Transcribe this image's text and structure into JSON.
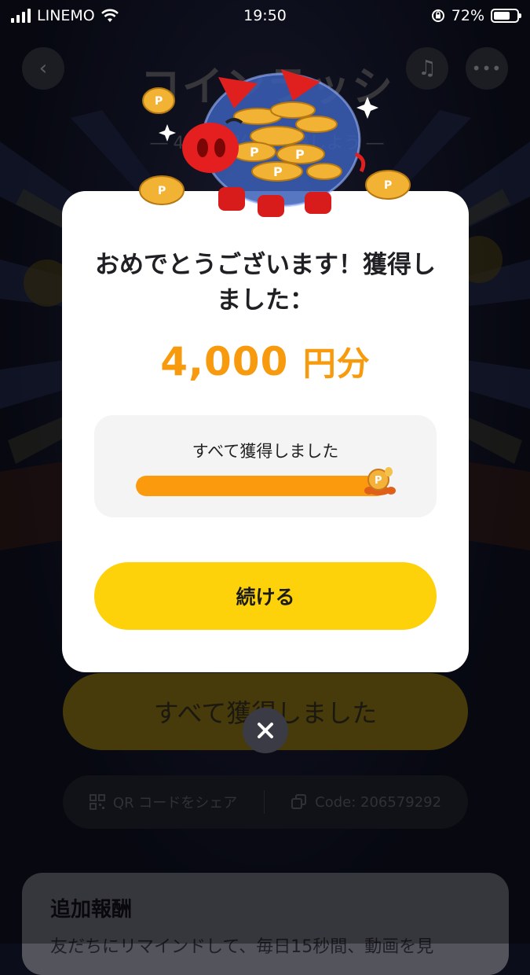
{
  "status_bar": {
    "carrier": "LINEMO",
    "time": "19:50",
    "battery": "72%",
    "battery_level": 0.72
  },
  "header": {
    "back_icon": "chevron-left-icon",
    "music_icon": "music-note-icon",
    "more_icon": "more-dots-icon",
    "title": "コインラッシュ",
    "subtitle": "― 4,000円分を獲得しよう ―"
  },
  "modal": {
    "title": "おめでとうございます！獲得しました：",
    "reward_amount": "4,000",
    "reward_unit": "円分",
    "progress_label": "すべて獲得しました",
    "progress_fraction": 1.0,
    "continue_label": "続ける"
  },
  "background": {
    "main_button_label": "すべて獲得しました",
    "share_qr_label": "QR コードをシェア",
    "code_label": "Code: 206579292",
    "extra_reward_heading": "追加報酬",
    "extra_reward_text": "友だちにリマインドして、毎日15秒間、動画を見"
  },
  "colors": {
    "accent_orange": "#f79a0d",
    "button_yellow": "#fdd20a",
    "modal_bg": "#ffffff"
  }
}
